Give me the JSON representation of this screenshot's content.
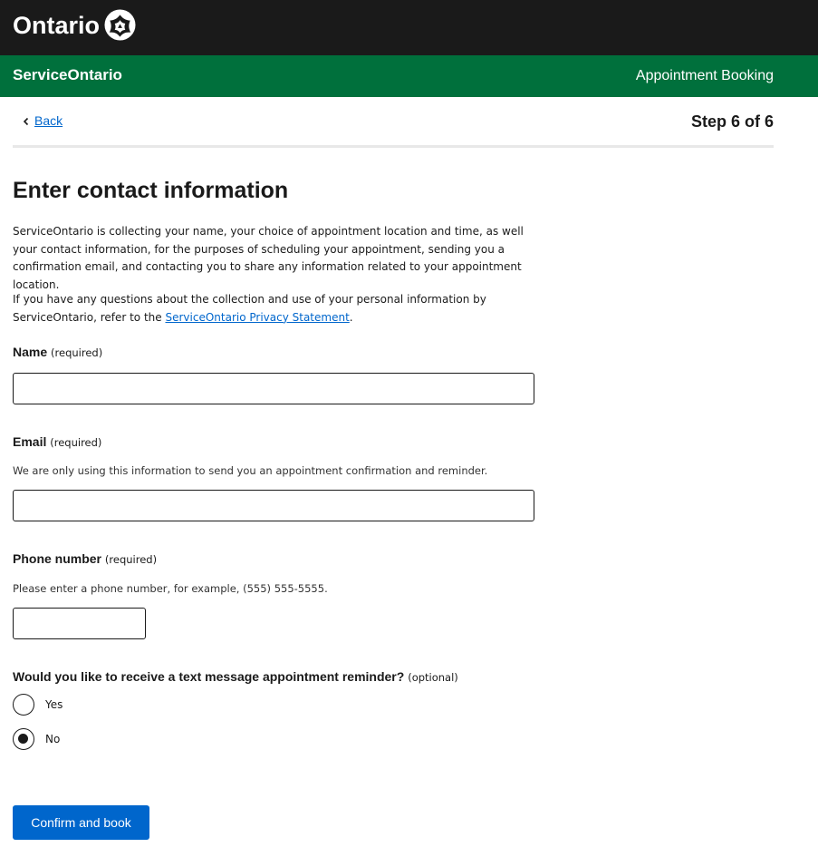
{
  "header": {
    "logo_text": "Ontario",
    "service_name": "ServiceOntario",
    "app_name": "Appointment Booking"
  },
  "nav": {
    "back_label": "Back",
    "step_text": "Step 6 of 6"
  },
  "main": {
    "title": "Enter contact information",
    "para1": "ServiceOntario is collecting your name, your choice of appointment location and time, as well your contact information, for the purposes of scheduling your appointment, sending you a confirmation email, and contacting you to share any information related to your appointment location.",
    "para2_prefix": "If you have any questions about the collection and use of your personal information by ServiceOntario, refer to the ",
    "para2_link": "ServiceOntario Privacy Statement",
    "para2_suffix": "."
  },
  "form": {
    "name": {
      "label": "Name",
      "hint": "(required)",
      "value": ""
    },
    "email": {
      "label": "Email",
      "hint": "(required)",
      "help": "We are only using this information to send you an appointment confirmation and reminder.",
      "value": ""
    },
    "phone": {
      "label": "Phone number",
      "hint": "(required)",
      "help": "Please enter a phone number, for example, (555) 555-5555.",
      "value": ""
    },
    "reminder": {
      "label": "Would you like to receive a text message appointment reminder?",
      "hint": "(optional)",
      "options": [
        {
          "label": "Yes",
          "selected": false
        },
        {
          "label": "No",
          "selected": true
        }
      ]
    },
    "submit_label": "Confirm and book"
  },
  "colors": {
    "topbar": "#1a1a1a",
    "greenbar": "#00703c",
    "primary_button": "#0066cc",
    "link": "#0066cc"
  },
  "icons": {
    "logo": "ontario-trillium-icon",
    "back": "chevron-left-icon"
  }
}
